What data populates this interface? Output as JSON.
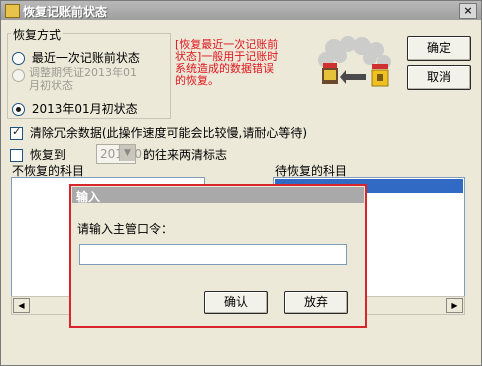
{
  "window": {
    "title": "恢复记账前状态",
    "close_glyph": "×"
  },
  "restore_mode": {
    "legend": "恢复方式",
    "options": [
      {
        "label": "最近一次记账前状态",
        "checked": false,
        "disabled": false
      },
      {
        "label_line1": "调整期凭证2013年01",
        "label_line2": "月初状态",
        "checked": false,
        "disabled": true
      },
      {
        "label": "2013年01月初状态",
        "checked": true,
        "disabled": false
      }
    ]
  },
  "notice": {
    "line1": "[恢复最近一次记账前",
    "line2": "状态]一般用于记账时",
    "line3": "系统造成的数据错误",
    "line4": "的恢复。",
    "color": "#e0141e"
  },
  "illustration": {
    "icon": "restore-illustration-icon"
  },
  "buttons": {
    "confirm": "确定",
    "cancel": "取消"
  },
  "options": {
    "clear_redundant": {
      "label": "清除冗余数据(此操作速度可能会比较慢,请耐心等待)",
      "checked": true
    },
    "restore_to": {
      "label": "恢复到",
      "period_value": "2013.01",
      "suffix": "的往来两清标志",
      "checked": false
    }
  },
  "lists": {
    "left_header": "不恢复的科目",
    "right_header": "待恢复的科目"
  },
  "dialog": {
    "title": "输入",
    "prompt": "请输入主管口令：",
    "password_value": "",
    "ok_label": "确认",
    "cancel_label": "放弃",
    "border_color": "#d8262c"
  }
}
